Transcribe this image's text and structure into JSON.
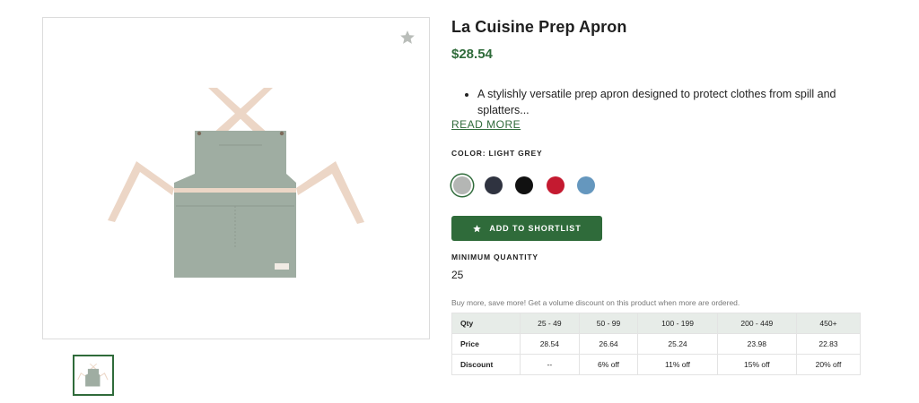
{
  "product": {
    "title": "La Cuisine Prep Apron",
    "price": "$28.54",
    "description": "A stylishly versatile prep apron designed to protect clothes from spill and splatters...",
    "read_more": "READ MORE",
    "color_label": "COLOR: LIGHT GREY",
    "favorite_icon": "star-icon"
  },
  "colors": [
    {
      "name": "Light Grey",
      "hex": "#b4b6b4",
      "selected": true
    },
    {
      "name": "Navy",
      "hex": "#2f3340",
      "selected": false
    },
    {
      "name": "Black",
      "hex": "#111111",
      "selected": false
    },
    {
      "name": "Red",
      "hex": "#c41a30",
      "selected": false
    },
    {
      "name": "Blue",
      "hex": "#6597be",
      "selected": false
    }
  ],
  "actions": {
    "shortlist_label": "ADD TO SHORTLIST",
    "shortlist_icon": "star-icon"
  },
  "quantity": {
    "label": "MINIMUM QUANTITY",
    "value": "25"
  },
  "volume_note": "Buy more, save more! Get a volume discount on this product when more are ordered.",
  "pricing_table": {
    "rows": [
      {
        "label": "Qty",
        "cells": [
          "25 - 49",
          "50 - 99",
          "100 - 199",
          "200 - 449",
          "450+"
        ]
      },
      {
        "label": "Price",
        "cells": [
          "28.54",
          "26.64",
          "25.24",
          "23.98",
          "22.83"
        ]
      },
      {
        "label": "Discount",
        "cells": [
          "--",
          "6% off",
          "11% off",
          "15% off",
          "20% off"
        ]
      }
    ]
  },
  "theme": {
    "accent": "#2f6b3a",
    "apron_body": "#9fada2",
    "apron_strap": "#ecd6c6",
    "table_header_bg": "#e7ece8"
  }
}
